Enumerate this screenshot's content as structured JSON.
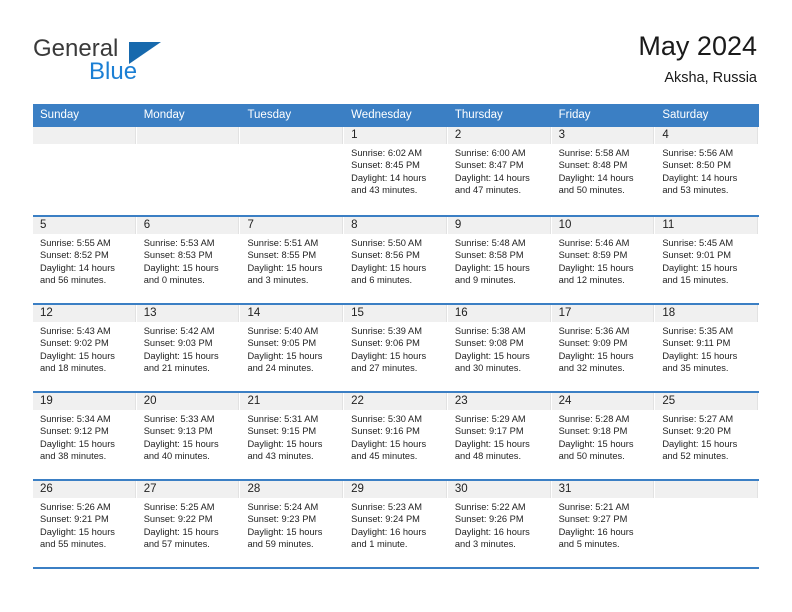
{
  "brand": {
    "name_part1": "General",
    "name_part2": "Blue",
    "triangle_icon": "triangle-icon",
    "color_primary": "#1769ad",
    "color_secondary": "#1b7fd4"
  },
  "header": {
    "title": "May 2024",
    "subtitle": "Aksha, Russia"
  },
  "theme": {
    "header_bg": "#3b7fc4",
    "row_divider": "#3b7fc4",
    "daynum_bg": "#f0f0f0"
  },
  "calendar": {
    "day_names": [
      "Sunday",
      "Monday",
      "Tuesday",
      "Wednesday",
      "Thursday",
      "Friday",
      "Saturday"
    ],
    "weeks": [
      [
        {
          "day": "",
          "lines": []
        },
        {
          "day": "",
          "lines": []
        },
        {
          "day": "",
          "lines": []
        },
        {
          "day": "1",
          "lines": [
            "Sunrise: 6:02 AM",
            "Sunset: 8:45 PM",
            "Daylight: 14 hours",
            "and 43 minutes."
          ]
        },
        {
          "day": "2",
          "lines": [
            "Sunrise: 6:00 AM",
            "Sunset: 8:47 PM",
            "Daylight: 14 hours",
            "and 47 minutes."
          ]
        },
        {
          "day": "3",
          "lines": [
            "Sunrise: 5:58 AM",
            "Sunset: 8:48 PM",
            "Daylight: 14 hours",
            "and 50 minutes."
          ]
        },
        {
          "day": "4",
          "lines": [
            "Sunrise: 5:56 AM",
            "Sunset: 8:50 PM",
            "Daylight: 14 hours",
            "and 53 minutes."
          ]
        }
      ],
      [
        {
          "day": "5",
          "lines": [
            "Sunrise: 5:55 AM",
            "Sunset: 8:52 PM",
            "Daylight: 14 hours",
            "and 56 minutes."
          ]
        },
        {
          "day": "6",
          "lines": [
            "Sunrise: 5:53 AM",
            "Sunset: 8:53 PM",
            "Daylight: 15 hours",
            "and 0 minutes."
          ]
        },
        {
          "day": "7",
          "lines": [
            "Sunrise: 5:51 AM",
            "Sunset: 8:55 PM",
            "Daylight: 15 hours",
            "and 3 minutes."
          ]
        },
        {
          "day": "8",
          "lines": [
            "Sunrise: 5:50 AM",
            "Sunset: 8:56 PM",
            "Daylight: 15 hours",
            "and 6 minutes."
          ]
        },
        {
          "day": "9",
          "lines": [
            "Sunrise: 5:48 AM",
            "Sunset: 8:58 PM",
            "Daylight: 15 hours",
            "and 9 minutes."
          ]
        },
        {
          "day": "10",
          "lines": [
            "Sunrise: 5:46 AM",
            "Sunset: 8:59 PM",
            "Daylight: 15 hours",
            "and 12 minutes."
          ]
        },
        {
          "day": "11",
          "lines": [
            "Sunrise: 5:45 AM",
            "Sunset: 9:01 PM",
            "Daylight: 15 hours",
            "and 15 minutes."
          ]
        }
      ],
      [
        {
          "day": "12",
          "lines": [
            "Sunrise: 5:43 AM",
            "Sunset: 9:02 PM",
            "Daylight: 15 hours",
            "and 18 minutes."
          ]
        },
        {
          "day": "13",
          "lines": [
            "Sunrise: 5:42 AM",
            "Sunset: 9:03 PM",
            "Daylight: 15 hours",
            "and 21 minutes."
          ]
        },
        {
          "day": "14",
          "lines": [
            "Sunrise: 5:40 AM",
            "Sunset: 9:05 PM",
            "Daylight: 15 hours",
            "and 24 minutes."
          ]
        },
        {
          "day": "15",
          "lines": [
            "Sunrise: 5:39 AM",
            "Sunset: 9:06 PM",
            "Daylight: 15 hours",
            "and 27 minutes."
          ]
        },
        {
          "day": "16",
          "lines": [
            "Sunrise: 5:38 AM",
            "Sunset: 9:08 PM",
            "Daylight: 15 hours",
            "and 30 minutes."
          ]
        },
        {
          "day": "17",
          "lines": [
            "Sunrise: 5:36 AM",
            "Sunset: 9:09 PM",
            "Daylight: 15 hours",
            "and 32 minutes."
          ]
        },
        {
          "day": "18",
          "lines": [
            "Sunrise: 5:35 AM",
            "Sunset: 9:11 PM",
            "Daylight: 15 hours",
            "and 35 minutes."
          ]
        }
      ],
      [
        {
          "day": "19",
          "lines": [
            "Sunrise: 5:34 AM",
            "Sunset: 9:12 PM",
            "Daylight: 15 hours",
            "and 38 minutes."
          ]
        },
        {
          "day": "20",
          "lines": [
            "Sunrise: 5:33 AM",
            "Sunset: 9:13 PM",
            "Daylight: 15 hours",
            "and 40 minutes."
          ]
        },
        {
          "day": "21",
          "lines": [
            "Sunrise: 5:31 AM",
            "Sunset: 9:15 PM",
            "Daylight: 15 hours",
            "and 43 minutes."
          ]
        },
        {
          "day": "22",
          "lines": [
            "Sunrise: 5:30 AM",
            "Sunset: 9:16 PM",
            "Daylight: 15 hours",
            "and 45 minutes."
          ]
        },
        {
          "day": "23",
          "lines": [
            "Sunrise: 5:29 AM",
            "Sunset: 9:17 PM",
            "Daylight: 15 hours",
            "and 48 minutes."
          ]
        },
        {
          "day": "24",
          "lines": [
            "Sunrise: 5:28 AM",
            "Sunset: 9:18 PM",
            "Daylight: 15 hours",
            "and 50 minutes."
          ]
        },
        {
          "day": "25",
          "lines": [
            "Sunrise: 5:27 AM",
            "Sunset: 9:20 PM",
            "Daylight: 15 hours",
            "and 52 minutes."
          ]
        }
      ],
      [
        {
          "day": "26",
          "lines": [
            "Sunrise: 5:26 AM",
            "Sunset: 9:21 PM",
            "Daylight: 15 hours",
            "and 55 minutes."
          ]
        },
        {
          "day": "27",
          "lines": [
            "Sunrise: 5:25 AM",
            "Sunset: 9:22 PM",
            "Daylight: 15 hours",
            "and 57 minutes."
          ]
        },
        {
          "day": "28",
          "lines": [
            "Sunrise: 5:24 AM",
            "Sunset: 9:23 PM",
            "Daylight: 15 hours",
            "and 59 minutes."
          ]
        },
        {
          "day": "29",
          "lines": [
            "Sunrise: 5:23 AM",
            "Sunset: 9:24 PM",
            "Daylight: 16 hours",
            "and 1 minute."
          ]
        },
        {
          "day": "30",
          "lines": [
            "Sunrise: 5:22 AM",
            "Sunset: 9:26 PM",
            "Daylight: 16 hours",
            "and 3 minutes."
          ]
        },
        {
          "day": "31",
          "lines": [
            "Sunrise: 5:21 AM",
            "Sunset: 9:27 PM",
            "Daylight: 16 hours",
            "and 5 minutes."
          ]
        },
        {
          "day": "",
          "lines": []
        }
      ]
    ]
  }
}
